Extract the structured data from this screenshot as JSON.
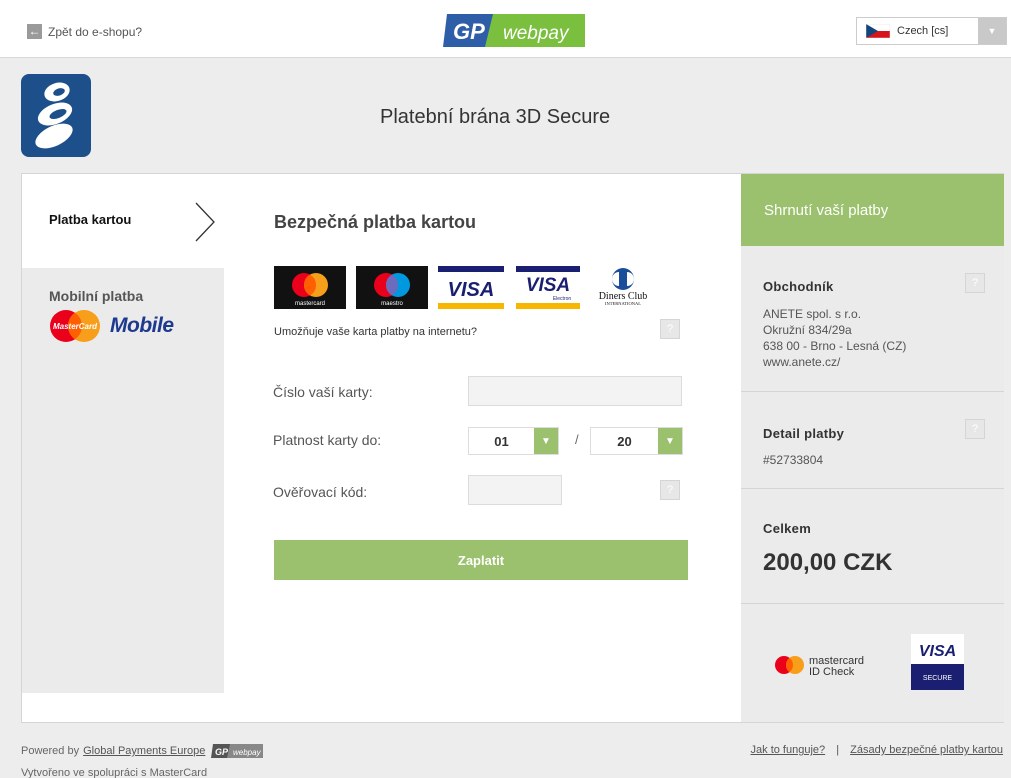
{
  "topbar": {
    "back_label": "Zpět do e-shopu?",
    "logo_gp": "GP",
    "logo_webpay": "webpay",
    "language": "Czech [cs]"
  },
  "header": {
    "title": "Platební brána 3D Secure"
  },
  "nav": {
    "card_tab": "Platba kartou",
    "mobile_tab": "Mobilní platba",
    "mobile_brand": "Mobile",
    "mobile_mc_text": "MasterCard"
  },
  "form": {
    "title": "Bezpečná platba kartou",
    "question": "Umožňuje vaše karta platby na internetu?",
    "card_number_label": "Číslo vaší karty:",
    "card_number_value": "",
    "expiry_label": "Platnost karty do:",
    "expiry_month": "01",
    "expiry_year": "20",
    "expiry_separator": "/",
    "cvc_label": "Ověřovací kód:",
    "cvc_value": "",
    "pay_button": "Zaplatit",
    "help_glyph": "?",
    "card_logos": {
      "mastercard": "mastercard",
      "maestro": "maestro",
      "visa": "VISA",
      "visa_electron": "VISA",
      "visa_electron_sub": "Electron",
      "diners_line1": "Diners Club",
      "diners_line2": "INTERNATIONAL"
    }
  },
  "summary": {
    "title": "Shrnutí vaší platby",
    "merchant_title": "Obchodník",
    "merchant_lines": [
      "ANETE spol. s r.o.",
      "Okružní 834/29a",
      "638 00 - Brno - Lesná (CZ)",
      "www.anete.cz/"
    ],
    "detail_title": "Detail platby",
    "detail_value": "#52733804",
    "total_title": "Celkem",
    "total_value": "200,00 CZK",
    "mc_idcheck_line1": "mastercard",
    "mc_idcheck_line2": "ID Check",
    "visa_secure_line1": "VISA",
    "visa_secure_line2": "SECURE"
  },
  "footer": {
    "powered_by": "Powered by",
    "powered_link": "Global Payments Europe",
    "created_with": "Vytvořeno ve spolupráci s MasterCard",
    "how_link": "Jak to funguje?",
    "separator": "|",
    "security_link": "Zásady bezpečné platby kartou"
  },
  "colors": {
    "accent_green": "#9bc16e",
    "gp_blue": "#2f5ea8",
    "gp_green": "#7bbf3f",
    "mc_red": "#eb001b",
    "mc_yellow": "#f79e1b",
    "visa_blue": "#1a1f71"
  }
}
